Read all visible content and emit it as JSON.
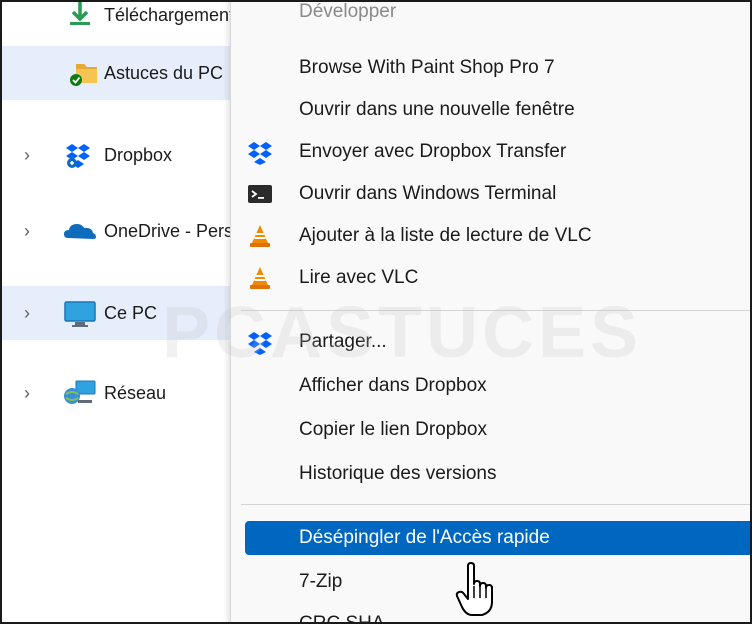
{
  "sidebar": {
    "items": [
      {
        "label": "Téléchargements",
        "icon": "download-icon"
      },
      {
        "label": "Astuces du PC",
        "icon": "pinned-folder-icon",
        "selected": true
      },
      {
        "label": "Dropbox",
        "icon": "dropbox-icon"
      },
      {
        "label": "OneDrive - Personnel",
        "icon": "onedrive-cloud-icon"
      },
      {
        "label": "Ce PC",
        "icon": "computer-icon"
      },
      {
        "label": "Réseau",
        "icon": "network-icon"
      }
    ]
  },
  "menu": {
    "top_partial": "Développer",
    "items": [
      {
        "label": "Browse With Paint Shop Pro 7",
        "icon": ""
      },
      {
        "label": "Ouvrir dans une nouvelle fenêtre",
        "icon": ""
      },
      {
        "label": "Envoyer avec Dropbox Transfer",
        "icon": "dropbox-icon"
      },
      {
        "label": "Ouvrir dans Windows Terminal",
        "icon": "terminal-icon"
      },
      {
        "label": "Ajouter à la liste de lecture de VLC",
        "icon": "vlc-icon"
      },
      {
        "label": "Lire avec VLC",
        "icon": "vlc-icon"
      },
      {
        "label": "Partager...",
        "icon": "dropbox-icon"
      },
      {
        "label": "Afficher dans Dropbox",
        "icon": ""
      },
      {
        "label": "Copier le lien Dropbox",
        "icon": ""
      },
      {
        "label": "Historique des versions",
        "icon": ""
      },
      {
        "label": "Désépingler de l'Accès rapide",
        "icon": "",
        "highlighted": true
      },
      {
        "label": "7-Zip",
        "icon": ""
      },
      {
        "label": "CRC SHA",
        "icon": ""
      }
    ]
  },
  "watermark": "PCASTUCES",
  "colors": {
    "accent": "#0067c0",
    "selected_bg": "#e5eefa",
    "menu_bg": "#f9f9f9"
  }
}
